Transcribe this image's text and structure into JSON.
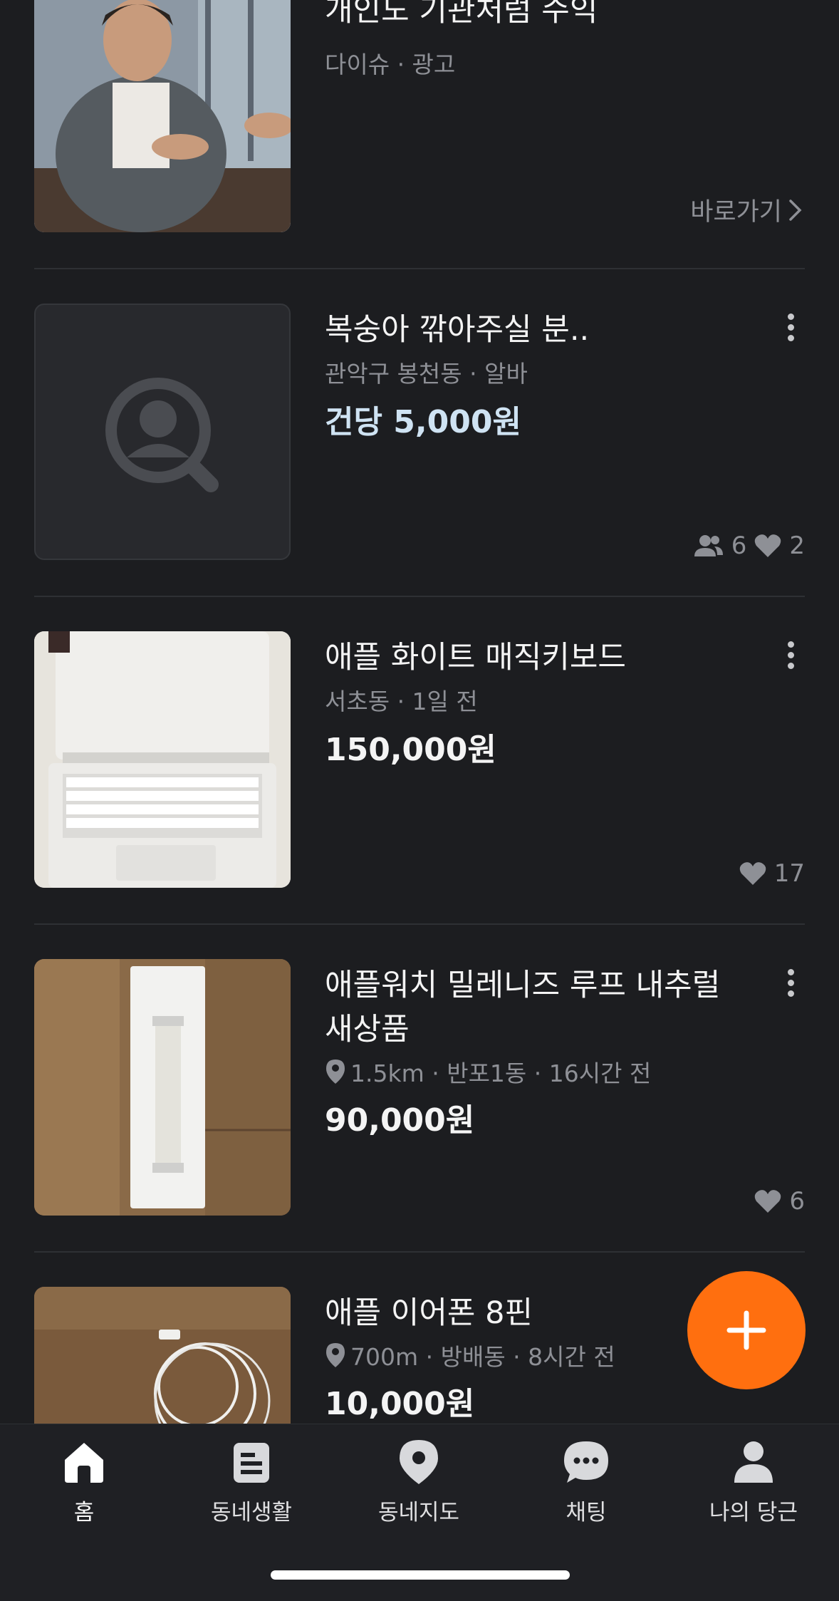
{
  "items": [
    {
      "title": "개인도 기관처럼 수익",
      "meta": "다이슈 · 광고",
      "link_label": "바로가기"
    },
    {
      "title": "복숭아 깎아주실 분..",
      "meta": "관악구 봉천동 · 알바",
      "price": "건당 5,000원",
      "people_count": "6",
      "likes": "2"
    },
    {
      "title": "애플 화이트 매직키보드",
      "meta": "서초동 · 1일 전",
      "price": "150,000원",
      "likes": "17"
    },
    {
      "title_line1": "애플워치 밀레니즈 루프 내추럴",
      "title_line2": "새상품",
      "meta": "1.5km · 반포1동 · 16시간 전",
      "price": "90,000원",
      "likes": "6"
    },
    {
      "title": "애플 이어폰 8핀",
      "meta": "700m · 방배동 · 8시간 전",
      "price": "10,000원"
    }
  ],
  "nav": {
    "home": "홈",
    "community": "동네생활",
    "map": "동네지도",
    "chat": "채팅",
    "my": "나의 당근"
  },
  "colors": {
    "background": "#1c1d20",
    "accent": "#ff6f0f",
    "price_job": "#cfe3f3"
  }
}
